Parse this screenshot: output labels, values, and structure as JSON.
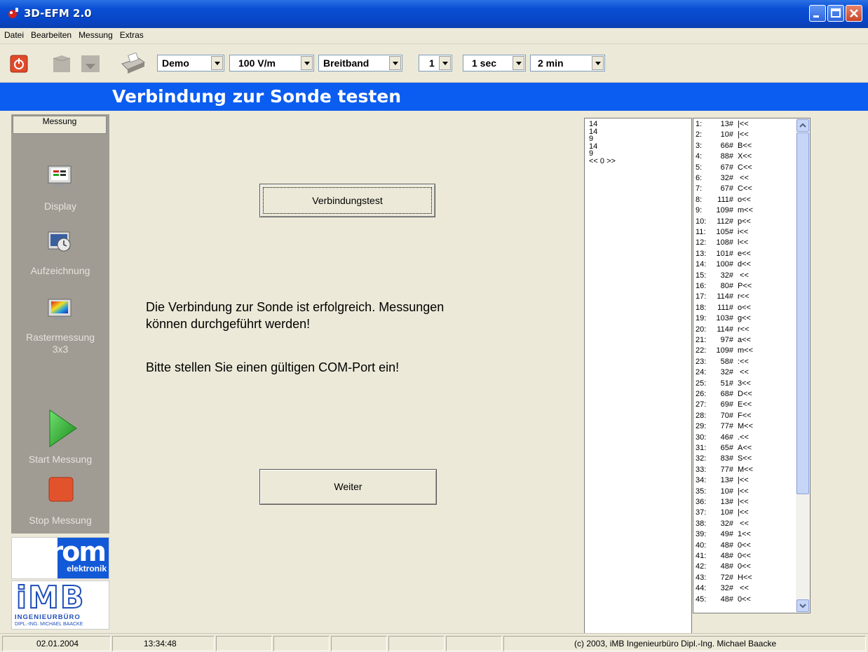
{
  "window": {
    "title": "3D-EFM 2.0"
  },
  "menu": [
    "Datei",
    "Bearbeiten",
    "Messung",
    "Extras"
  ],
  "toolbar": {
    "combos": [
      {
        "name": "mode-select",
        "value": "Demo"
      },
      {
        "name": "range-select",
        "value": "100 V/m"
      },
      {
        "name": "band-select",
        "value": "Breitband"
      },
      {
        "name": "channel-select",
        "value": "1"
      },
      {
        "name": "interval-select",
        "value": "1 sec"
      },
      {
        "name": "duration-select",
        "value": "2 min"
      }
    ]
  },
  "header": {
    "title": "Verbindung zur Sonde testen"
  },
  "sidebar": {
    "header": "Messung",
    "items": {
      "display": "Display",
      "aufzeichnung": "Aufzeichnung",
      "raster": "Rastermessung",
      "raster_sub": "3x3",
      "start": "Start Messung",
      "stop": "Stop Messung"
    },
    "logo_rom": {
      "main": "rom",
      "sub": "elektronik"
    },
    "logo_imb": {
      "main": "iMB",
      "line1": "INGENIEURBÜRO",
      "line2": "DIPL.-ING. MICHAEL BAACKE"
    }
  },
  "main": {
    "test_button": "Verbindungstest",
    "message1_line1": "Die Verbindung zur Sonde ist erfolgreich. Messungen",
    "message1_line2": "können durchgeführt werden!",
    "message2": "Bitte stellen Sie einen gültigen COM-Port ein!",
    "next_button": "Weiter"
  },
  "raw_list": [
    "14",
    "14",
    "9",
    "14",
    "9",
    "<< 0 >>"
  ],
  "char_list": [
    {
      "n": "1:",
      "code": "13#",
      "chr": "|<<"
    },
    {
      "n": "2:",
      "code": "10#",
      "chr": "|<<"
    },
    {
      "n": "3:",
      "code": "66#",
      "chr": "B<<"
    },
    {
      "n": "4:",
      "code": "88#",
      "chr": "X<<"
    },
    {
      "n": "5:",
      "code": "67#",
      "chr": "C<<"
    },
    {
      "n": "6:",
      "code": "32#",
      "chr": " <<"
    },
    {
      "n": "7:",
      "code": "67#",
      "chr": "C<<"
    },
    {
      "n": "8:",
      "code": "111#",
      "chr": "o<<"
    },
    {
      "n": "9:",
      "code": "109#",
      "chr": "m<<"
    },
    {
      "n": "10:",
      "code": "112#",
      "chr": "p<<"
    },
    {
      "n": "11:",
      "code": "105#",
      "chr": "i<<"
    },
    {
      "n": "12:",
      "code": "108#",
      "chr": "l<<"
    },
    {
      "n": "13:",
      "code": "101#",
      "chr": "e<<"
    },
    {
      "n": "14:",
      "code": "100#",
      "chr": "d<<"
    },
    {
      "n": "15:",
      "code": "32#",
      "chr": " <<"
    },
    {
      "n": "16:",
      "code": "80#",
      "chr": "P<<"
    },
    {
      "n": "17:",
      "code": "114#",
      "chr": "r<<"
    },
    {
      "n": "18:",
      "code": "111#",
      "chr": "o<<"
    },
    {
      "n": "19:",
      "code": "103#",
      "chr": "g<<"
    },
    {
      "n": "20:",
      "code": "114#",
      "chr": "r<<"
    },
    {
      "n": "21:",
      "code": "97#",
      "chr": "a<<"
    },
    {
      "n": "22:",
      "code": "109#",
      "chr": "m<<"
    },
    {
      "n": "23:",
      "code": "58#",
      "chr": ":<<"
    },
    {
      "n": "24:",
      "code": "32#",
      "chr": " <<"
    },
    {
      "n": "25:",
      "code": "51#",
      "chr": "3<<"
    },
    {
      "n": "26:",
      "code": "68#",
      "chr": "D<<"
    },
    {
      "n": "27:",
      "code": "69#",
      "chr": "E<<"
    },
    {
      "n": "28:",
      "code": "70#",
      "chr": "F<<"
    },
    {
      "n": "29:",
      "code": "77#",
      "chr": "M<<"
    },
    {
      "n": "30:",
      "code": "46#",
      "chr": ".<<"
    },
    {
      "n": "31:",
      "code": "65#",
      "chr": "A<<"
    },
    {
      "n": "32:",
      "code": "83#",
      "chr": "S<<"
    },
    {
      "n": "33:",
      "code": "77#",
      "chr": "M<<"
    },
    {
      "n": "34:",
      "code": "13#",
      "chr": "|<<"
    },
    {
      "n": "35:",
      "code": "10#",
      "chr": "|<<"
    },
    {
      "n": "36:",
      "code": "13#",
      "chr": "|<<"
    },
    {
      "n": "37:",
      "code": "10#",
      "chr": "|<<"
    },
    {
      "n": "38:",
      "code": "32#",
      "chr": " <<"
    },
    {
      "n": "39:",
      "code": "49#",
      "chr": "1<<"
    },
    {
      "n": "40:",
      "code": "48#",
      "chr": "0<<"
    },
    {
      "n": "41:",
      "code": "48#",
      "chr": "0<<"
    },
    {
      "n": "42:",
      "code": "48#",
      "chr": "0<<"
    },
    {
      "n": "43:",
      "code": "72#",
      "chr": "H<<"
    },
    {
      "n": "44:",
      "code": "32#",
      "chr": " <<"
    },
    {
      "n": "45:",
      "code": "48#",
      "chr": "0<<"
    }
  ],
  "status": {
    "date": "02.01.2004",
    "time": "13:34:48",
    "copyright": "(c) 2003,  iMB  Ingenieurbüro Dipl.-Ing. Michael Baacke"
  },
  "colors": {
    "header_blue": "#0b5cf0",
    "sidebar": "#a09c94",
    "start_green": "#2fae2f",
    "stop_red": "#e2532d"
  }
}
